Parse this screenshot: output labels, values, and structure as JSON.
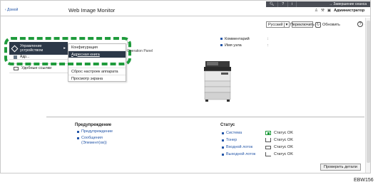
{
  "topbar": {
    "icons": [
      "search-icon",
      "help-icon",
      "info-icon"
    ],
    "logout_label": "Завершение сеанса"
  },
  "header": {
    "back_link": "‹ Домой",
    "title": "Web Image Monitor",
    "user_label": "Администратор"
  },
  "toolbar": {
    "language": "Русский",
    "switch_label": "Переключить",
    "refresh_label": "Обновить"
  },
  "nav": {
    "active_line1": "Управление",
    "active_line2": "устройством",
    "item2": "Адр...",
    "item3": "Удобные ссылки"
  },
  "submenu": {
    "items": [
      "Конфигурация",
      "Адресная книга",
      "Сброс настроек аппарата",
      "Просмотр экрана"
    ]
  },
  "main": {
    "op_panel": "Operation Panel",
    "info": [
      {
        "label": "Комментарий",
        "value": ":"
      },
      {
        "label": "Имя узла",
        "value": ":"
      }
    ]
  },
  "warning": {
    "title": "Предупреждение",
    "items": [
      "Предупреждение",
      "Сообщения",
      "(Элемент(ов))"
    ]
  },
  "status": {
    "title": "Статус",
    "rows": [
      {
        "name": "Система",
        "value": "Статус OK"
      },
      {
        "name": "Тонер",
        "value": "Статус OK"
      },
      {
        "name": "Входной лоток",
        "value": "Статус OK"
      },
      {
        "name": "Выходной лоток",
        "value": "Статус OK"
      }
    ],
    "details_label": "Проверить детали"
  },
  "figure_code": "EBW156",
  "colors": {
    "nav_active": "#2c3848",
    "highlight": "#1f9b3c",
    "link": "#2456a8",
    "topbar": "#4a4d55"
  }
}
